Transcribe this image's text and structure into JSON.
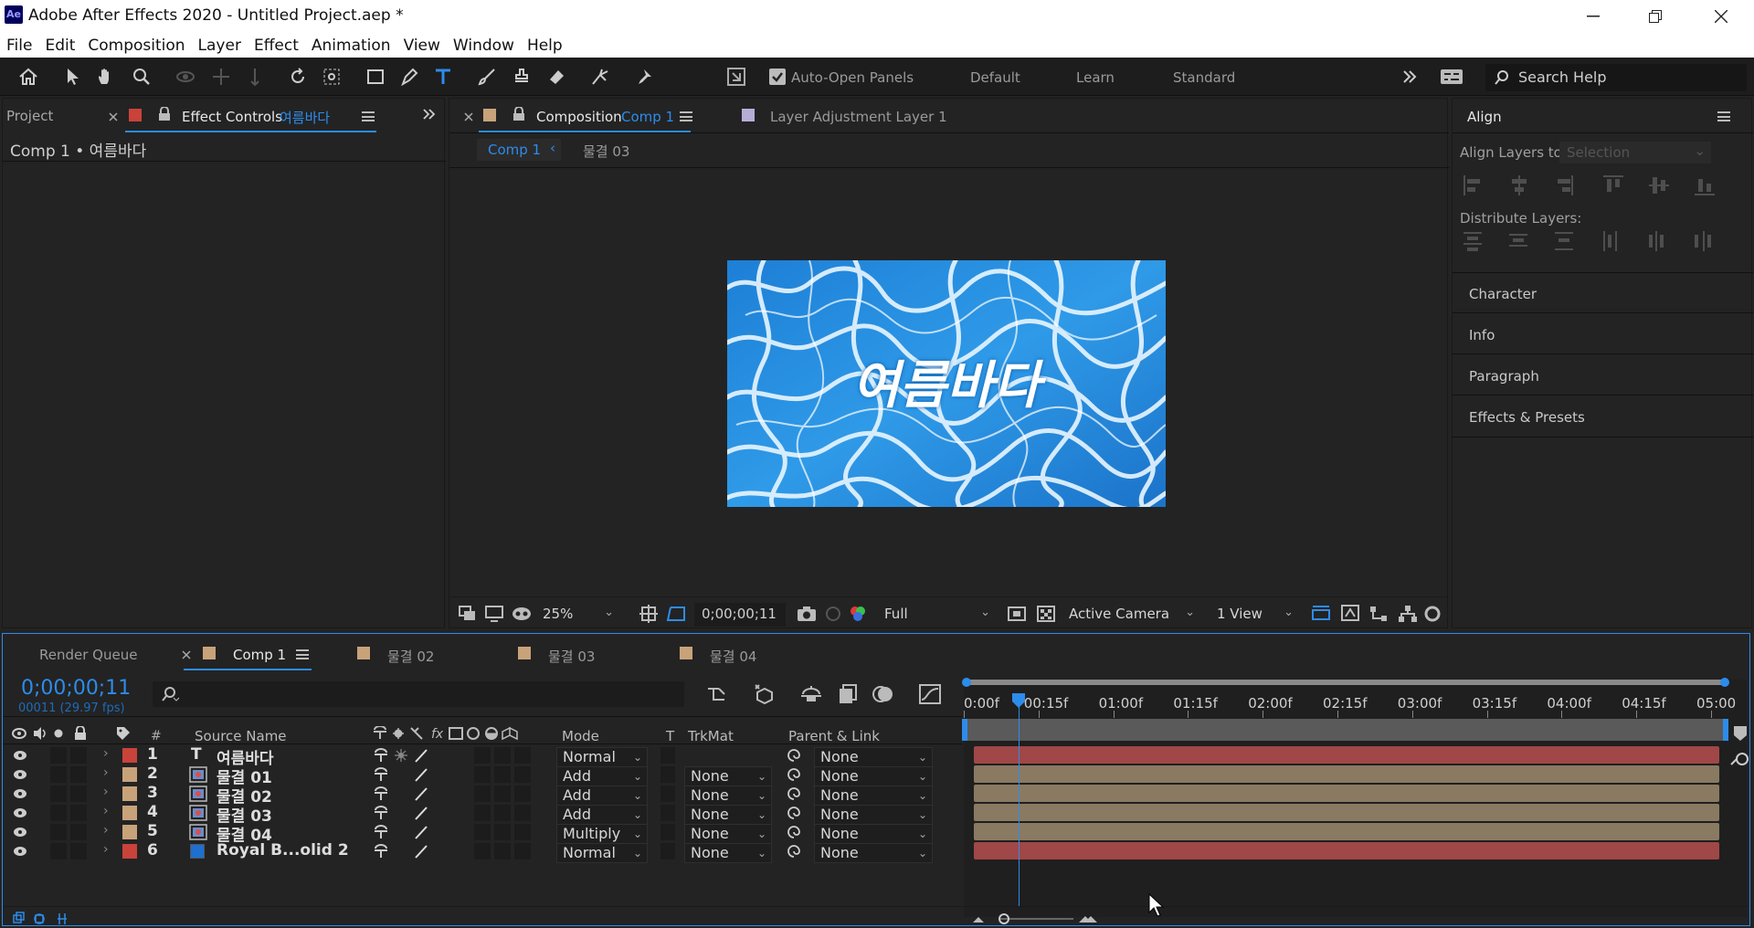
{
  "window": {
    "title": "Adobe After Effects 2020 - Untitled Project.aep *",
    "app_badge": "Ae"
  },
  "menu": [
    "File",
    "Edit",
    "Composition",
    "Layer",
    "Effect",
    "Animation",
    "View",
    "Window",
    "Help"
  ],
  "toolbar": {
    "auto_open_label": "Auto-Open Panels",
    "workspaces": [
      "Default",
      "Learn",
      "Standard"
    ],
    "search_placeholder": "Search Help"
  },
  "left_panel": {
    "project_tab": "Project",
    "effect_controls_tab": "Effect Controls",
    "effect_controls_target": "여름바다",
    "breadcrumb": "Comp 1 • 여름바다"
  },
  "comp_panel": {
    "tab_prefix": "Composition",
    "tab_name": "Comp 1",
    "layer_tab": "Layer  Adjustment Layer 1",
    "subtabs": [
      "Comp 1",
      "물결 03"
    ],
    "viewer_text": "여름바다",
    "zoom": "25%",
    "timecode": "0;00;00;11",
    "resolution": "Full",
    "camera": "Active Camera",
    "views": "1 View"
  },
  "right_panel": {
    "align_title": "Align",
    "align_layers_to": "Align Layers to:",
    "align_target": "Selection",
    "distribute_layers": "Distribute Layers:",
    "sections": [
      "Character",
      "Info",
      "Paragraph",
      "Effects & Presets"
    ]
  },
  "timeline": {
    "tabs": [
      "Render Queue",
      "Comp 1",
      "물결 02",
      "물결 03",
      "물결 04"
    ],
    "timecode": "0;00;00;11",
    "frame_info": "00011 (29.97 fps)",
    "columns": {
      "num": "#",
      "source": "Source Name",
      "mode": "Mode",
      "t": "T",
      "trkmat": "TrkMat",
      "parent": "Parent & Link"
    },
    "ruler": [
      "0:00f",
      "00:15f",
      "01:00f",
      "01:15f",
      "02:00f",
      "02:15f",
      "03:00f",
      "03:15f",
      "04:00f",
      "04:15f",
      "05:00"
    ],
    "playhead_fraction": 0.073,
    "layers": [
      {
        "num": "1",
        "name": "여름바다",
        "type": "text",
        "mode": "Normal",
        "trkmat": "",
        "parent": "None",
        "label": "#c9433a",
        "bar": "#a04747"
      },
      {
        "num": "2",
        "name": "물결 01",
        "type": "footage",
        "mode": "Add",
        "trkmat": "None",
        "parent": "None",
        "label": "#c8a37a",
        "bar": "#8a7a62"
      },
      {
        "num": "3",
        "name": "물결 02",
        "type": "footage",
        "mode": "Add",
        "trkmat": "None",
        "parent": "None",
        "label": "#c8a37a",
        "bar": "#8a7a62"
      },
      {
        "num": "4",
        "name": "물결 03",
        "type": "footage",
        "mode": "Add",
        "trkmat": "None",
        "parent": "None",
        "label": "#c8a37a",
        "bar": "#8a7a62"
      },
      {
        "num": "5",
        "name": "물결 04",
        "type": "footage",
        "mode": "Multiply",
        "trkmat": "None",
        "parent": "None",
        "label": "#c8a37a",
        "bar": "#8a7a62"
      },
      {
        "num": "6",
        "name": "Royal B...olid 2",
        "type": "solid",
        "mode": "Normal",
        "trkmat": "None",
        "parent": "None",
        "label": "#c9433a",
        "bar": "#a04747"
      }
    ]
  },
  "colors": {
    "accent": "#2d8ceb",
    "panel_bg": "#232323",
    "red_label": "#c9433a",
    "tan_label": "#c8a37a"
  }
}
